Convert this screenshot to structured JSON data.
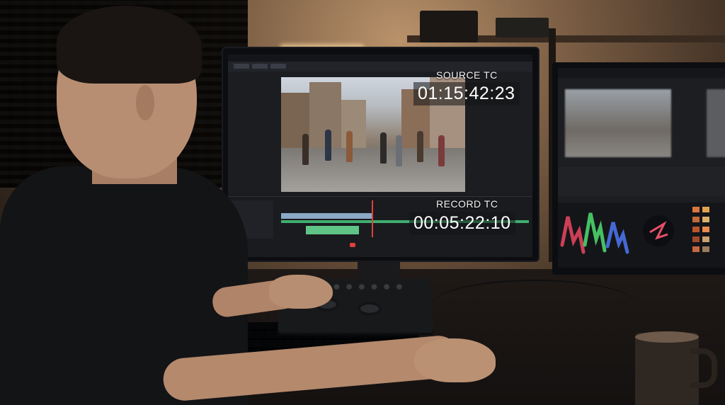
{
  "photo": {
    "source_monitor": {
      "source_tc_label": "SOURCE TC",
      "source_tc_value": "01:15:42:23",
      "record_tc_label": "RECORD TC",
      "record_tc_value": "00:05:22:10"
    }
  },
  "colors": {
    "timeline_video_track": "#8ca9c6",
    "timeline_audio_track": "#3fae70",
    "playhead": "#e0403a",
    "scope_red": "#e0445c",
    "scope_green": "#4ad36b",
    "scope_blue": "#4a72e8"
  },
  "icons": [
    "keyboard-icon",
    "control-panel-icon",
    "mug-icon"
  ]
}
